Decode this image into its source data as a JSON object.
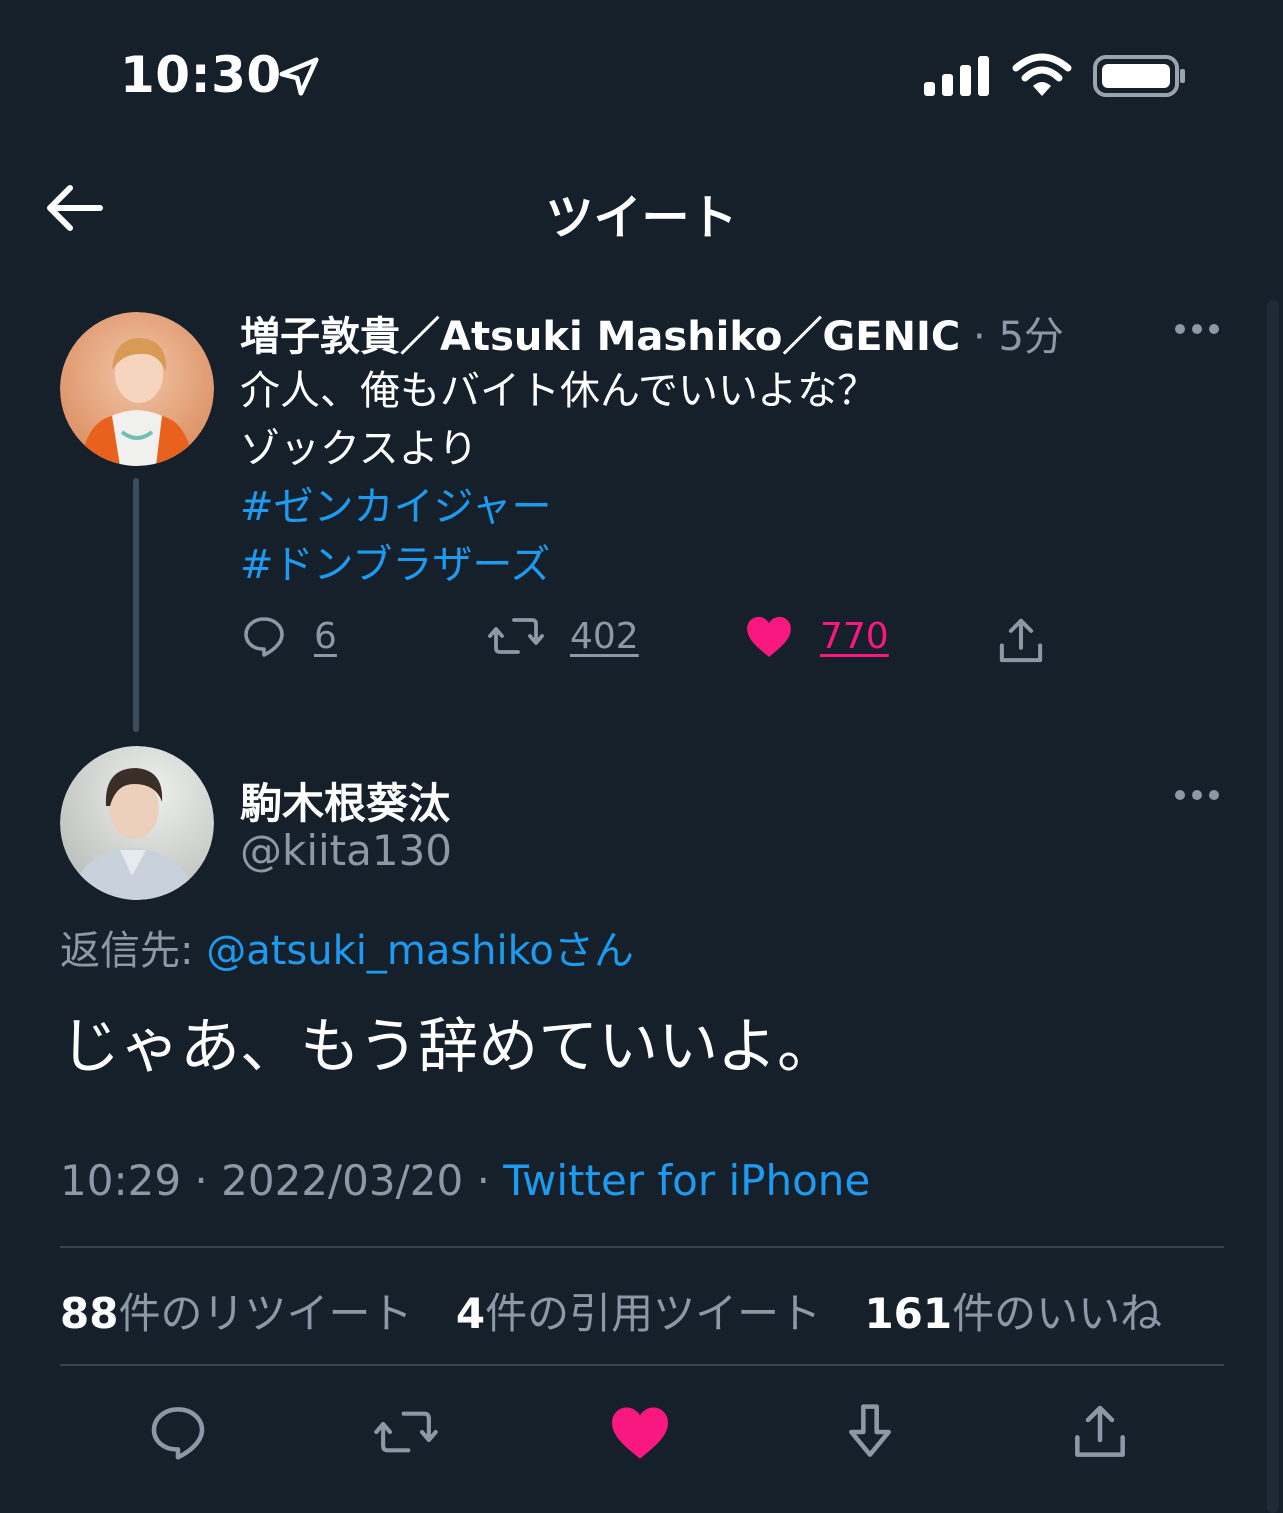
{
  "status_bar": {
    "time": "10:30",
    "icons": [
      "location-arrow-icon",
      "cellular-signal-icon",
      "wifi-icon",
      "battery-icon"
    ]
  },
  "header": {
    "title": "ツイート",
    "back_icon": "back-arrow-icon"
  },
  "parent_tweet": {
    "display_name": "増子敦貴／Atsuki Mashiko／GENIC",
    "separator": "·",
    "time_ago": "5分",
    "lines": [
      "介人、俺もバイト休んでいいよな？",
      "ゾックスより"
    ],
    "hashtags": [
      "#ゼンカイジャー",
      "#ドンブラザーズ"
    ],
    "actions": {
      "replies": "6",
      "retweets": "402",
      "likes": "770"
    }
  },
  "main_tweet": {
    "display_name": "駒木根葵汰",
    "handle": "@kiita130",
    "reply_prefix": "返信先: ",
    "reply_to": "@atsuki_mashiko",
    "reply_suffix": "さん",
    "text": "じゃあ、もう辞めていいよ。",
    "time": "10:29",
    "date": "2022/03/20",
    "separator": "·",
    "source": "Twitter for iPhone",
    "stats": {
      "retweets": "88",
      "retweets_label": "件のリツイート",
      "quotes": "4",
      "quotes_label": "件の引用ツイート",
      "likes": "161",
      "likes_label": "件のいいね"
    }
  },
  "colors": {
    "background": "#15202b",
    "link": "#1d9bf0",
    "like": "#f91880",
    "muted": "#8b98a5",
    "divider": "#38444d"
  }
}
